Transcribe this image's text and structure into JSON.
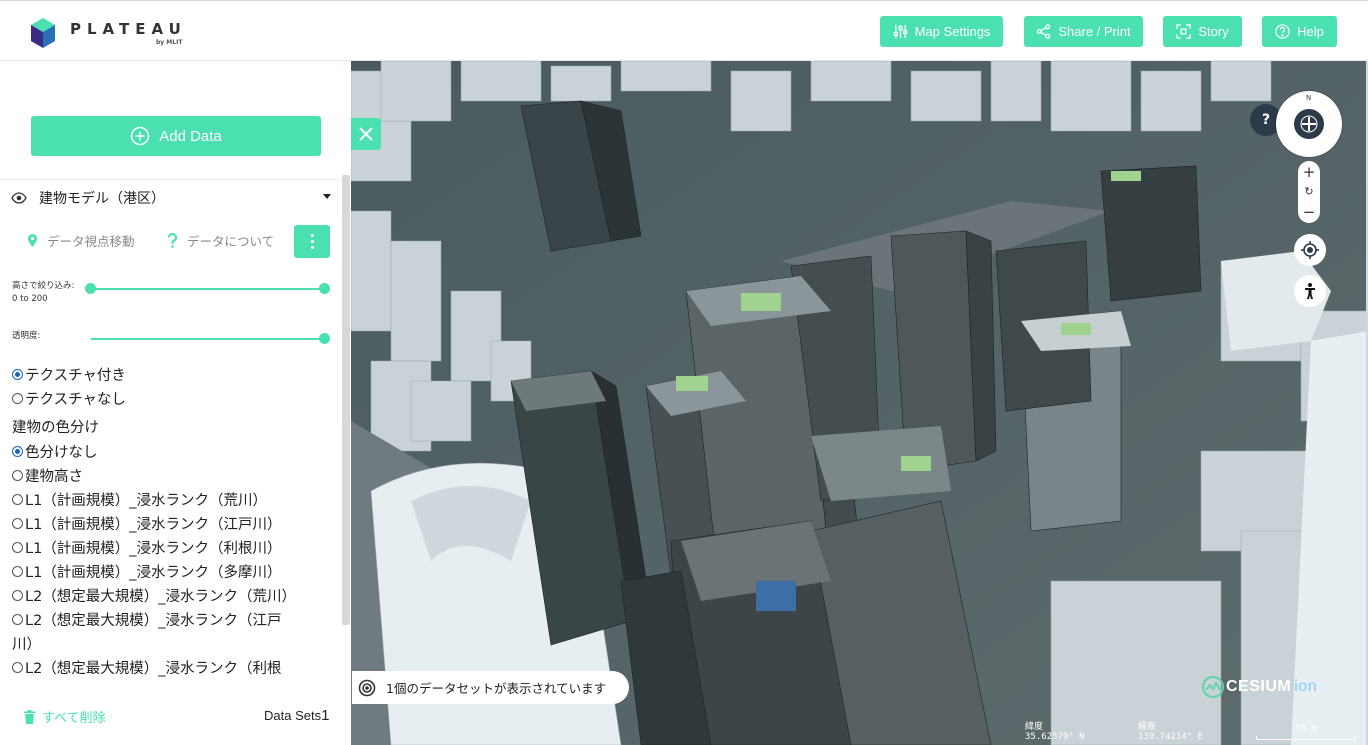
{
  "app": {
    "logo_word": "PLATEAU",
    "logo_sub": "by MLIT"
  },
  "header": {
    "buttons": [
      {
        "label": "Map Settings",
        "icon": "sliders-icon"
      },
      {
        "label": "Share / Print",
        "icon": "share-icon"
      },
      {
        "label": "Story",
        "icon": "story-icon"
      },
      {
        "label": "Help",
        "icon": "help-icon"
      }
    ]
  },
  "sidebar": {
    "add_data_label": "Add Data",
    "layer_title": "建物モデル（港区）",
    "actions": {
      "move_view": "データ視点移動",
      "about": "データについて"
    },
    "height_filter": {
      "label": "高さで絞り込み:",
      "range": "0 to 200",
      "min_fraction": 0,
      "max_fraction": 1
    },
    "opacity": {
      "label": "透明度:",
      "value_fraction": 1
    },
    "texture_options": [
      {
        "label": "テクスチャ付き",
        "selected": true
      },
      {
        "label": "テクスチャなし",
        "selected": false
      }
    ],
    "color_section_title": "建物の色分け",
    "color_options": [
      {
        "label": "色分けなし",
        "selected": true
      },
      {
        "label": "建物高さ",
        "selected": false
      },
      {
        "label": "L1（計画規模）_浸水ランク（荒川）",
        "selected": false
      },
      {
        "label": "L1（計画規模）_浸水ランク（江戸川）",
        "selected": false
      },
      {
        "label": "L1（計画規模）_浸水ランク（利根川）",
        "selected": false
      },
      {
        "label": "L1（計画規模）_浸水ランク（多摩川）",
        "selected": false
      },
      {
        "label": "L2（想定最大規模）_浸水ランク（荒川）",
        "selected": false
      },
      {
        "label": "L2（想定最大規模）_浸水ランク（江戸",
        "selected": false
      },
      {
        "label": "L2（想定最大規模）_浸水ランク（利根",
        "selected": false
      }
    ],
    "wrap_continuation": "川）",
    "delete_all": "すべて削除",
    "datasets_label": "Data Sets",
    "datasets_count": "1"
  },
  "map": {
    "status_text": "1個のデータセットが表示されています",
    "compass_letter": "N",
    "help_q": "?",
    "zoom_in": "+",
    "zoom_reset": "↻",
    "zoom_out": "−",
    "attribution": "CESIUM",
    "attribution_suffix": "ion",
    "lat_label": "緯度",
    "lat_value": "35.62579° N",
    "lon_label": "経度",
    "lon_value": "139.74214° E",
    "scale_label": "50 m"
  },
  "colors": {
    "accent": "#4be0b0",
    "radio_selected": "#1565c0",
    "nav_dark": "#2d3a4a"
  }
}
